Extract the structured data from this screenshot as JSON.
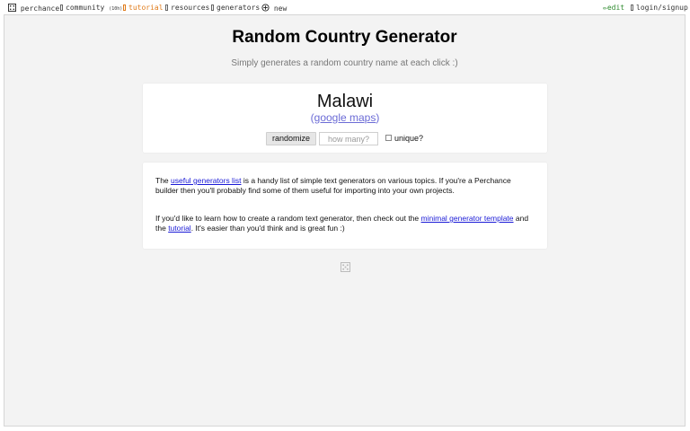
{
  "nav": {
    "logo_icon": "dice-icon",
    "perchance": "perchance",
    "community": "community",
    "community_count": "(10h)",
    "tutorial": "tutorial",
    "resources": "resources",
    "generators": "generators",
    "new": "new",
    "edit": "edit",
    "login": "login/signup"
  },
  "page": {
    "title": "Random Country Generator",
    "subtitle": "Simply generates a random country name at each click :)"
  },
  "result": {
    "country": "Malawi",
    "open_paren": "(",
    "maps_link": "google maps",
    "close_paren": ")"
  },
  "controls": {
    "randomize_label": "randomize",
    "howmany_placeholder": "how many?",
    "unique_label": "unique?"
  },
  "info": {
    "p1_before": "The ",
    "p1_link": "useful generators list",
    "p1_after": " is a handy list of simple text generators on various topics. If you're a Perchance builder then you'll probably find some of them useful for importing into your own projects.",
    "p2_before": "If you'd like to learn how to create a random text generator, then check out the ",
    "p2_link1": "minimal generator template",
    "p2_mid": " and the ",
    "p2_link2": "tutorial",
    "p2_after": ". It's easier than you'd think and is great fun :)"
  },
  "colors": {
    "accent_orange": "#e07b1a",
    "edit_green": "#2e8b2e",
    "link_blue": "#1a1ad6",
    "maps_link": "#6b6bd6"
  }
}
